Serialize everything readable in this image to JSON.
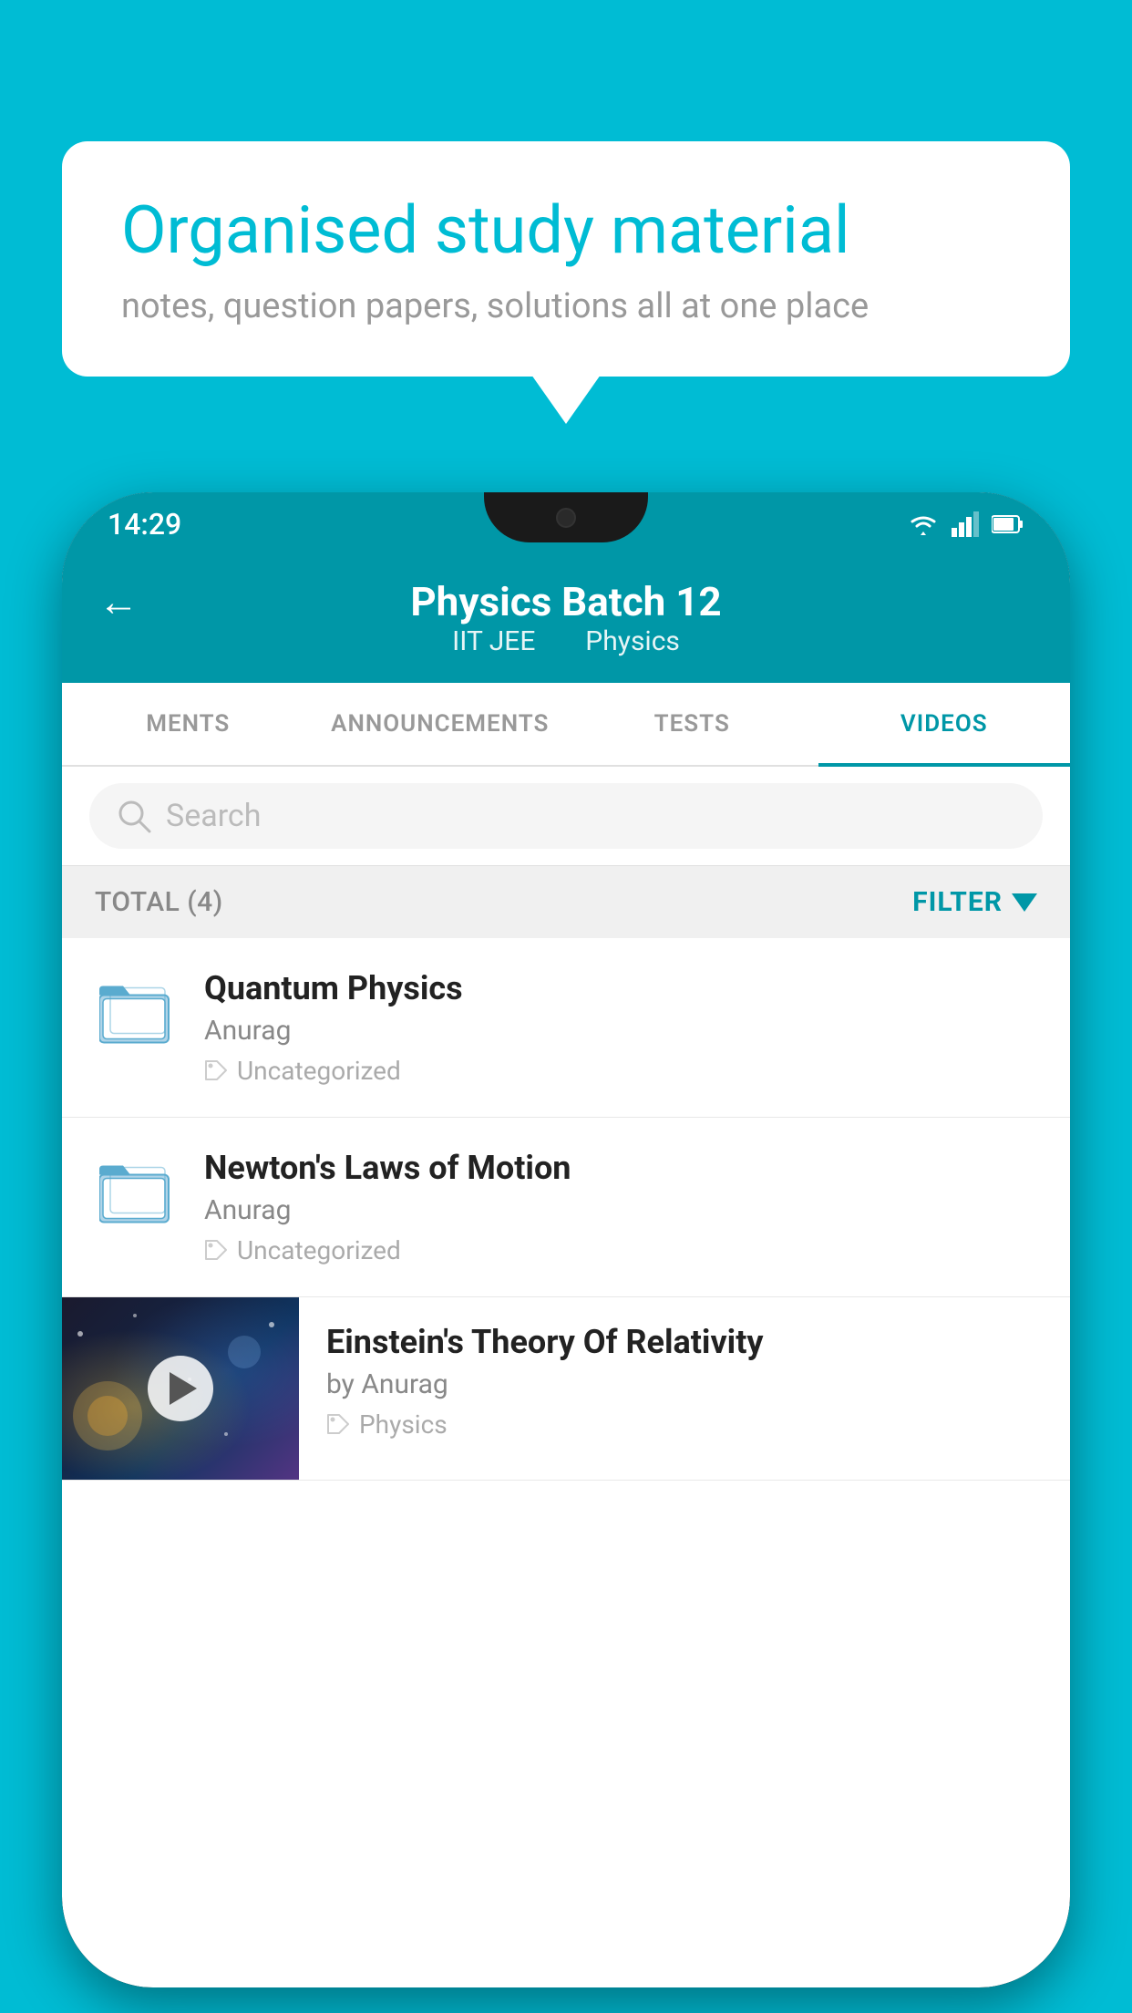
{
  "background_color": "#00bcd4",
  "speech_bubble": {
    "title": "Organised study material",
    "subtitle": "notes, question papers, solutions all at one place"
  },
  "status_bar": {
    "time": "14:29",
    "icons": [
      "wifi",
      "signal",
      "battery"
    ]
  },
  "app_header": {
    "back_label": "←",
    "title": "Physics Batch 12",
    "tag1": "IIT JEE",
    "tag2": "Physics"
  },
  "tabs": [
    {
      "label": "MENTS",
      "active": false
    },
    {
      "label": "ANNOUNCEMENTS",
      "active": false
    },
    {
      "label": "TESTS",
      "active": false
    },
    {
      "label": "VIDEOS",
      "active": true
    }
  ],
  "search": {
    "placeholder": "Search"
  },
  "filter_bar": {
    "total_label": "TOTAL (4)",
    "filter_label": "FILTER"
  },
  "list_items": [
    {
      "title": "Quantum Physics",
      "author": "Anurag",
      "tag": "Uncategorized",
      "type": "folder"
    },
    {
      "title": "Newton's Laws of Motion",
      "author": "Anurag",
      "tag": "Uncategorized",
      "type": "folder"
    },
    {
      "title": "Einstein's Theory Of Relativity",
      "author": "by Anurag",
      "tag": "Physics",
      "type": "video"
    }
  ]
}
